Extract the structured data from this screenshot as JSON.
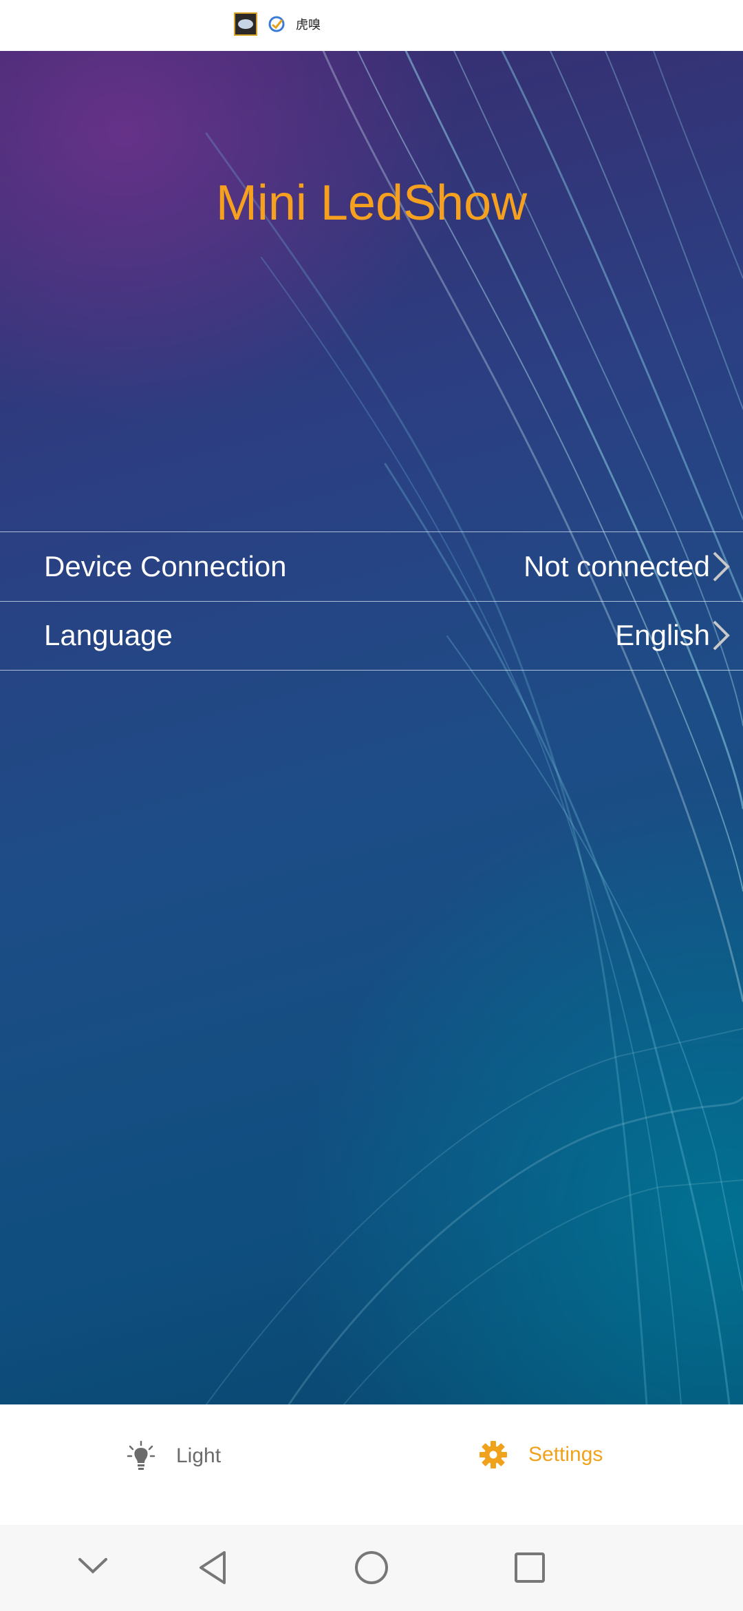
{
  "status_bar": {
    "app_icons": [
      "ledshow-app-icon",
      "check-circle-icon"
    ],
    "text": "虎嗅"
  },
  "app": {
    "title": "Mini LedShow"
  },
  "settings": {
    "rows": [
      {
        "label": "Device Connection",
        "value": "Not connected"
      },
      {
        "label": "Language",
        "value": "English"
      }
    ]
  },
  "tabs": [
    {
      "label": "Light",
      "icon": "lightbulb-icon",
      "active": false
    },
    {
      "label": "Settings",
      "icon": "gear-icon",
      "active": true
    }
  ],
  "colors": {
    "accent": "#f5a01f",
    "inactive_tab": "#6b6b6b"
  },
  "nav_bar": {
    "buttons": [
      "collapse-icon",
      "back-icon",
      "home-icon",
      "recents-icon"
    ]
  }
}
